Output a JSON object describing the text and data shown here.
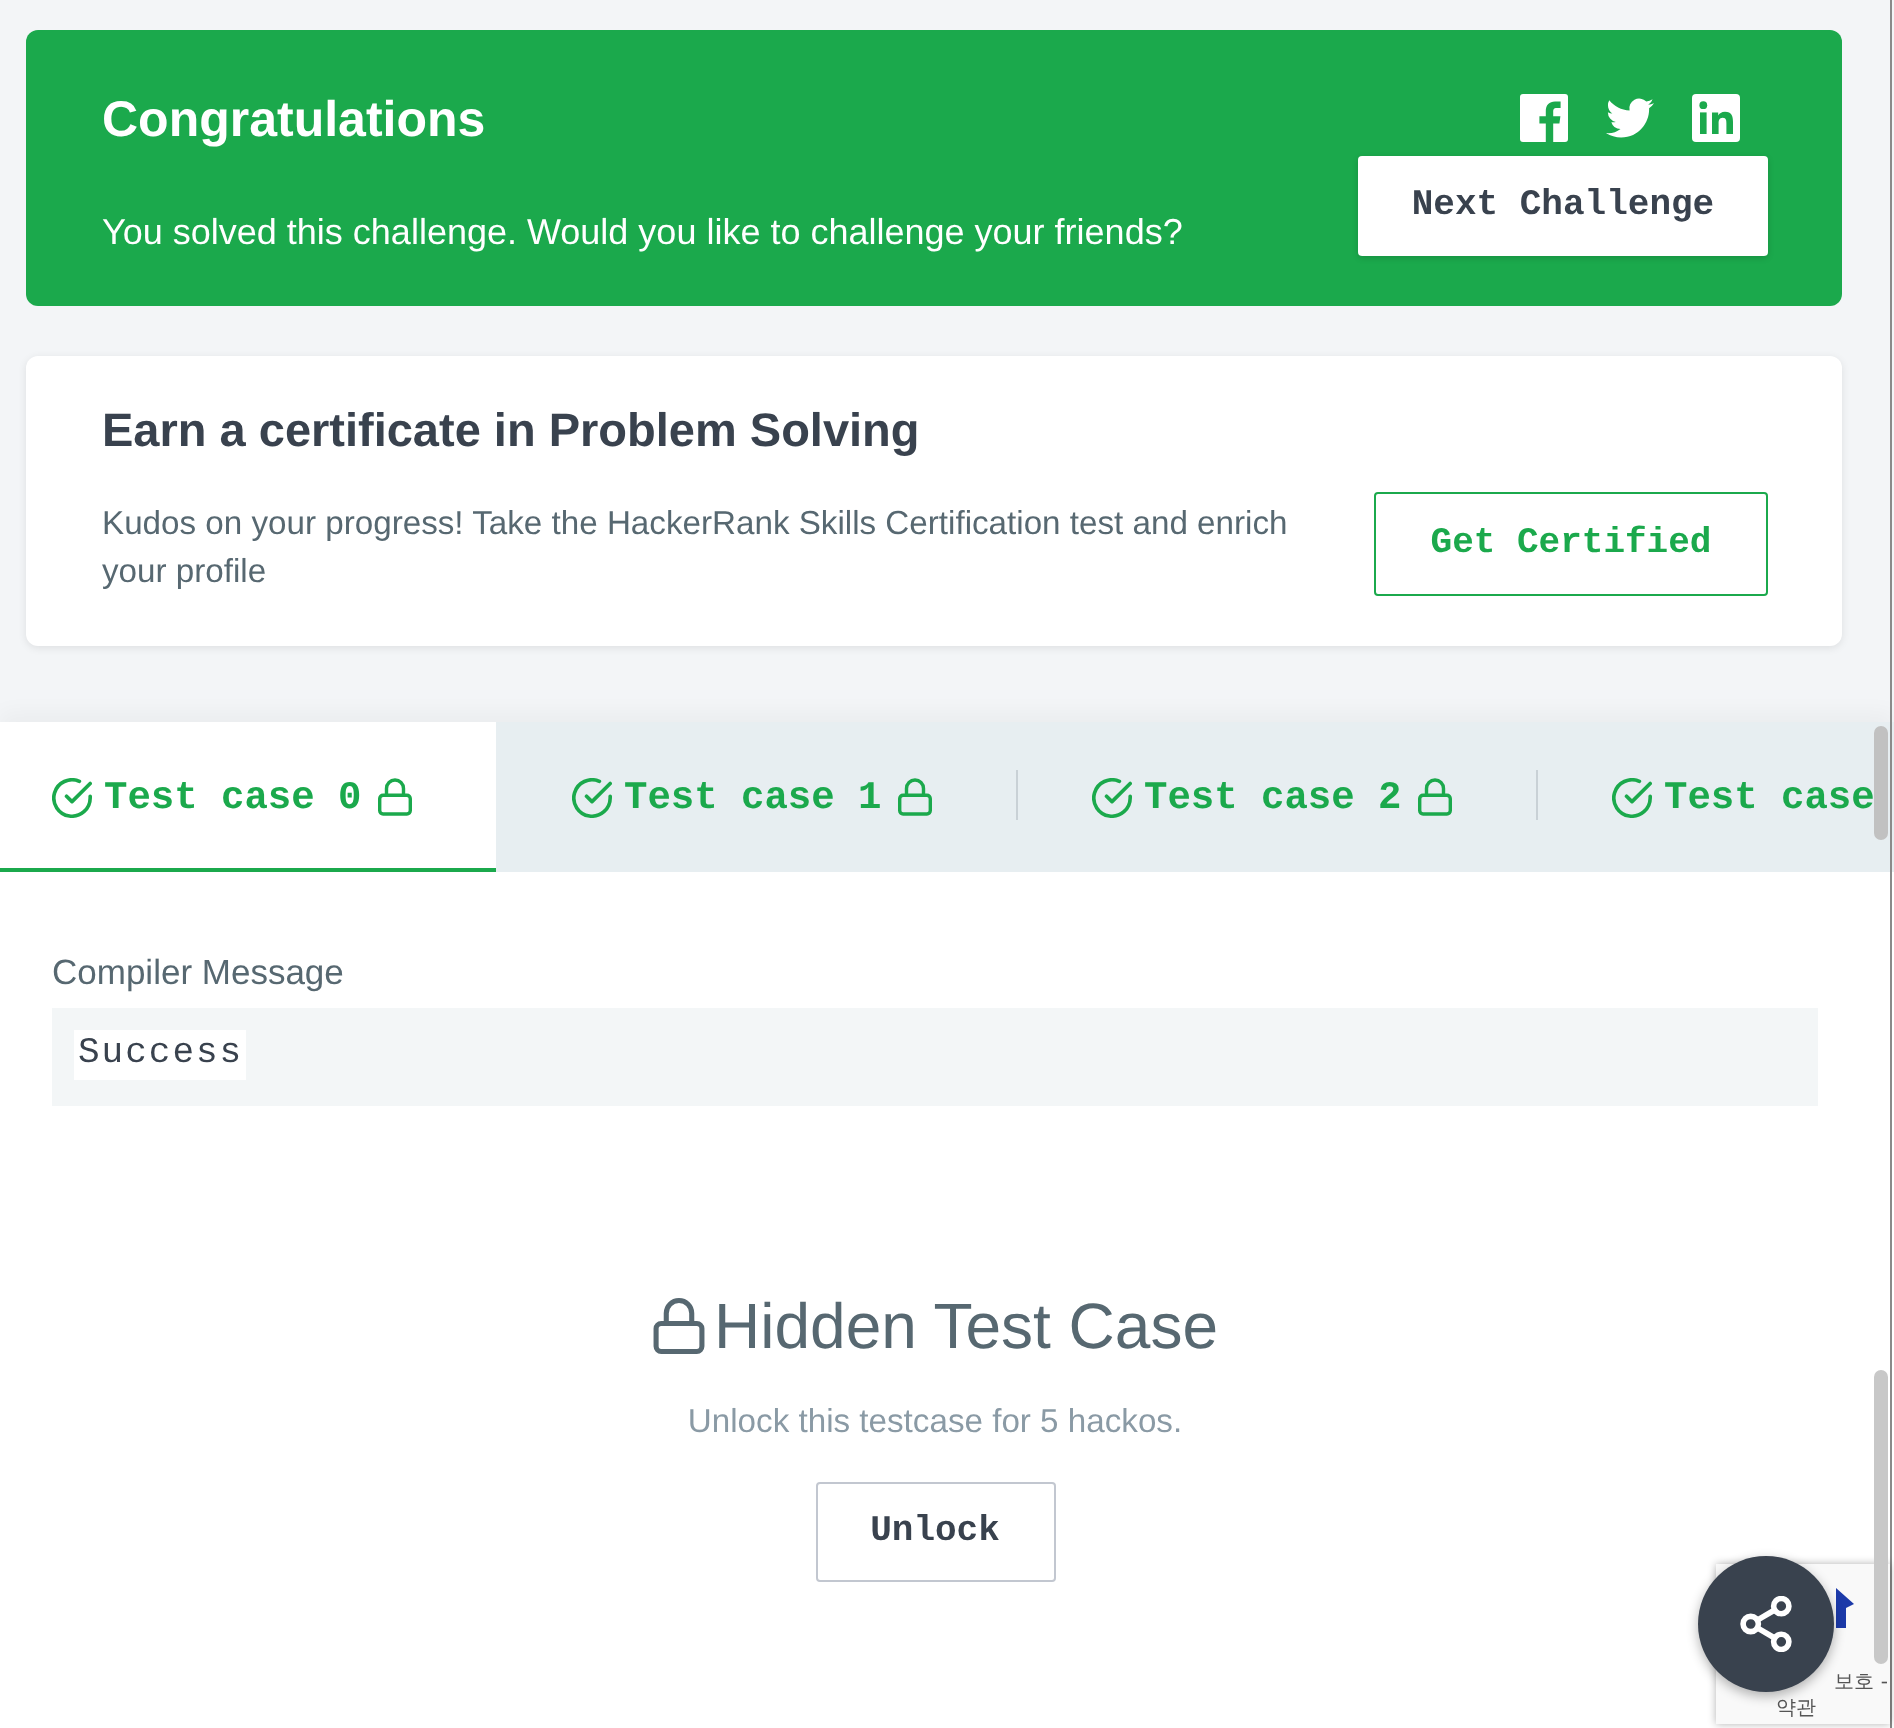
{
  "success_banner": {
    "title": "Congratulations",
    "message": "You solved this challenge. Would you like to challenge your friends?",
    "share_links": [
      {
        "kind": "facebook"
      },
      {
        "kind": "twitter"
      },
      {
        "kind": "linkedin"
      }
    ],
    "button": "Next Challenge"
  },
  "certificate_card": {
    "title": "Earn a certificate in Problem Solving",
    "description": "Kudos on your progress! Take the HackerRank Skills Certification test and enrich your profile",
    "button": "Get Certified"
  },
  "test_case_tabs": [
    {
      "label": "Test case 0",
      "passed": true,
      "locked": true,
      "selected": true
    },
    {
      "label": "Test case 1",
      "passed": true,
      "locked": true,
      "selected": false
    },
    {
      "label": "Test case 2",
      "passed": true,
      "locked": true,
      "selected": false
    },
    {
      "label": "Test case",
      "passed": true,
      "selected": false
    }
  ],
  "compiler_message": {
    "label": "Compiler Message",
    "output": "Success"
  },
  "hidden_test_case": {
    "title": "Hidden Test Case",
    "message": "Unlock this testcase for 5 hackos.",
    "button": "Unlock"
  },
  "recaptcha_badge": {
    "privacy_text": "보호 -",
    "terms_text": "약관"
  }
}
